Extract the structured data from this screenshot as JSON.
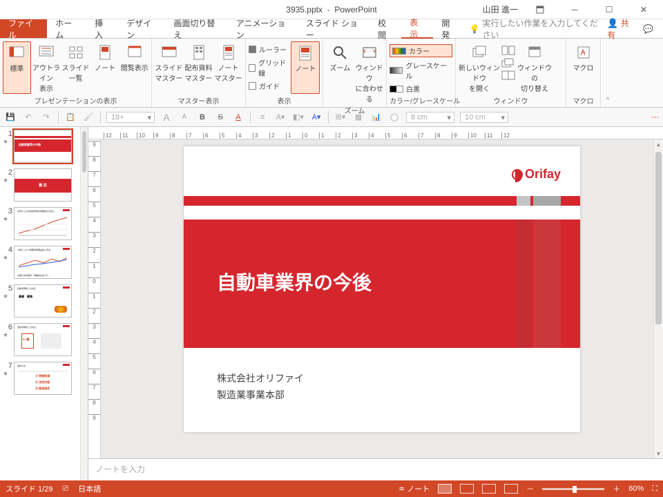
{
  "title_bar": {
    "filename": "3935.pptx",
    "app": "PowerPoint",
    "user": "山田 進一"
  },
  "tabs": {
    "file": "ファイル",
    "items": [
      "ホーム",
      "挿入",
      "デザイン",
      "画面切り替え",
      "アニメーション",
      "スライド ショー",
      "校閲",
      "表示",
      "開発"
    ],
    "active": "表示",
    "tell_me": "実行したい作業を入力してください",
    "share": "共有"
  },
  "ribbon": {
    "g1": {
      "label": "プレゼンテーションの表示",
      "items": [
        "標準",
        "アウトライン\n表示",
        "スライド\n一覧",
        "ノート",
        "閲覧表示"
      ]
    },
    "g2": {
      "label": "マスター表示",
      "items": [
        "スライド\nマスター",
        "配布資料\nマスター",
        "ノート\nマスター"
      ]
    },
    "g3": {
      "label": "表示",
      "items": [
        "ルーラー",
        "グリッド線",
        "ガイド"
      ],
      "note": "ノート"
    },
    "g4": {
      "label": "ズーム",
      "items": [
        "ズーム",
        "ウィンドウ\nに合わせる"
      ]
    },
    "g5": {
      "label": "カラー/グレースケール",
      "items": [
        "カラー",
        "グレースケール",
        "白黒"
      ]
    },
    "g6": {
      "label": "ウィンドウ",
      "items": [
        "新しいウィンドウ\nを開く",
        "ウィンドウの\n切り替え"
      ]
    },
    "g7": {
      "label": "マクロ",
      "items": [
        "マクロ"
      ]
    }
  },
  "qat": {
    "font_size": "18+",
    "w": "8 cm",
    "h": "10 cm"
  },
  "ruler_h": [
    "12",
    "11",
    "10",
    "9",
    "8",
    "7",
    "6",
    "5",
    "4",
    "3",
    "2",
    "1",
    "0",
    "1",
    "2",
    "3",
    "4",
    "5",
    "6",
    "7",
    "8",
    "9",
    "10",
    "11",
    "12"
  ],
  "ruler_v": [
    "9",
    "8",
    "7",
    "6",
    "5",
    "4",
    "3",
    "2",
    "1",
    "0",
    "1",
    "2",
    "3",
    "4",
    "5",
    "6",
    "7",
    "8",
    "9"
  ],
  "slide": {
    "logo": "Orifay",
    "title": "自動車業界の今後",
    "sub1": "株式会社オリファイ",
    "sub2": "製造業事業本部"
  },
  "thumbs": {
    "count": 7,
    "selected": 1
  },
  "notes_placeholder": "ノートを入力",
  "status": {
    "slide": "スライド 1/29",
    "lang": "日本語",
    "notes": "ノート",
    "zoom": "60%"
  }
}
